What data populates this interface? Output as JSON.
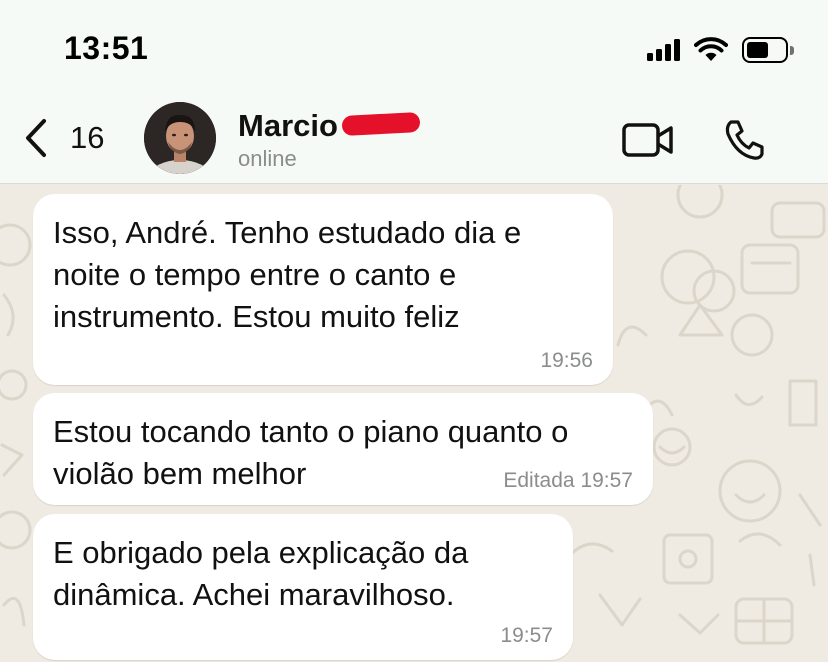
{
  "status_bar": {
    "time": "13:51",
    "icons": [
      "cellular-signal-icon",
      "wifi-icon",
      "battery-icon"
    ]
  },
  "header": {
    "back_count": "16",
    "contact_name": "Marcio",
    "contact_status": "online",
    "icons": {
      "back": "chevron-left-icon",
      "video": "video-camera-icon",
      "phone": "phone-icon"
    }
  },
  "messages": [
    {
      "lines": [
        "Isso, André.  Tenho estudado dia e",
        "noite o tempo entre o canto e",
        "instrumento.  Estou muito feliz"
      ],
      "time": "19:56",
      "edited_label": ""
    },
    {
      "lines": [
        "Estou tocando tanto o piano quanto o",
        "violão bem melhor"
      ],
      "time": "19:57",
      "edited_label": "Editada"
    },
    {
      "lines": [
        "E obrigado pela explicação da",
        "dinâmica.  Achei maravilhoso."
      ],
      "time": "19:57",
      "edited_label": ""
    }
  ],
  "colors": {
    "chat_background": "#efeae2",
    "header_background": "#f6faf6",
    "bubble": "#ffffff",
    "meta_text": "#8a8d8b",
    "redaction": "#e5102a"
  }
}
